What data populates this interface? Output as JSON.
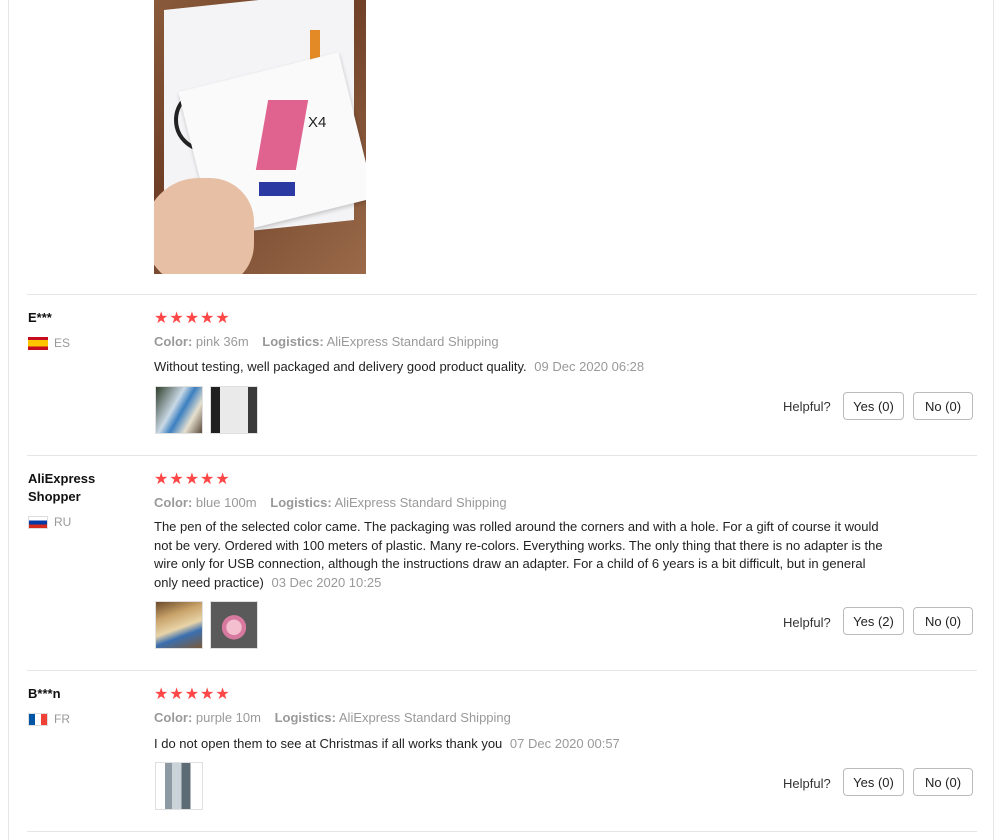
{
  "top_photo": {
    "overlay_text": "X4"
  },
  "helpful_label": "Helpful?",
  "reviews": [
    {
      "name": "E***",
      "country": "ES",
      "stars": "★★★★★",
      "color_label": "Color:",
      "color_value": "pink 36m",
      "logistics_label": "Logistics:",
      "logistics_value": "AliExpress Standard Shipping",
      "text": "Without testing, well packaged and delivery good product quality.",
      "date": "09 Dec 2020 06:28",
      "yes": "Yes (0)",
      "no": "No (0)"
    },
    {
      "name": "AliExpress Shopper",
      "country": "RU",
      "stars": "★★★★★",
      "color_label": "Color:",
      "color_value": "blue 100m",
      "logistics_label": "Logistics:",
      "logistics_value": "AliExpress Standard Shipping",
      "text": "The pen of the selected color came. The packaging was rolled around the corners and with a hole. For a gift of course it would not be very. Ordered with 100 meters of plastic. Many re-colors. Everything works. The only thing that there is no adapter is the wire only for USB connection, although the instructions draw an adapter. For a child of 6 years is a bit difficult, but in general only need practice)",
      "date": "03 Dec 2020 10:25",
      "yes": "Yes (2)",
      "no": "No (0)"
    },
    {
      "name": "B***n",
      "country": "FR",
      "stars": "★★★★★",
      "color_label": "Color:",
      "color_value": "purple 10m",
      "logistics_label": "Logistics:",
      "logistics_value": "AliExpress Standard Shipping",
      "text": "I do not open them to see at Christmas if all works thank you",
      "date": "07 Dec 2020 00:57",
      "yes": "Yes (0)",
      "no": "No (0)"
    }
  ],
  "colors": {
    "star": "#ff4747",
    "meta": "#999999",
    "divider": "#e6e6e6"
  }
}
